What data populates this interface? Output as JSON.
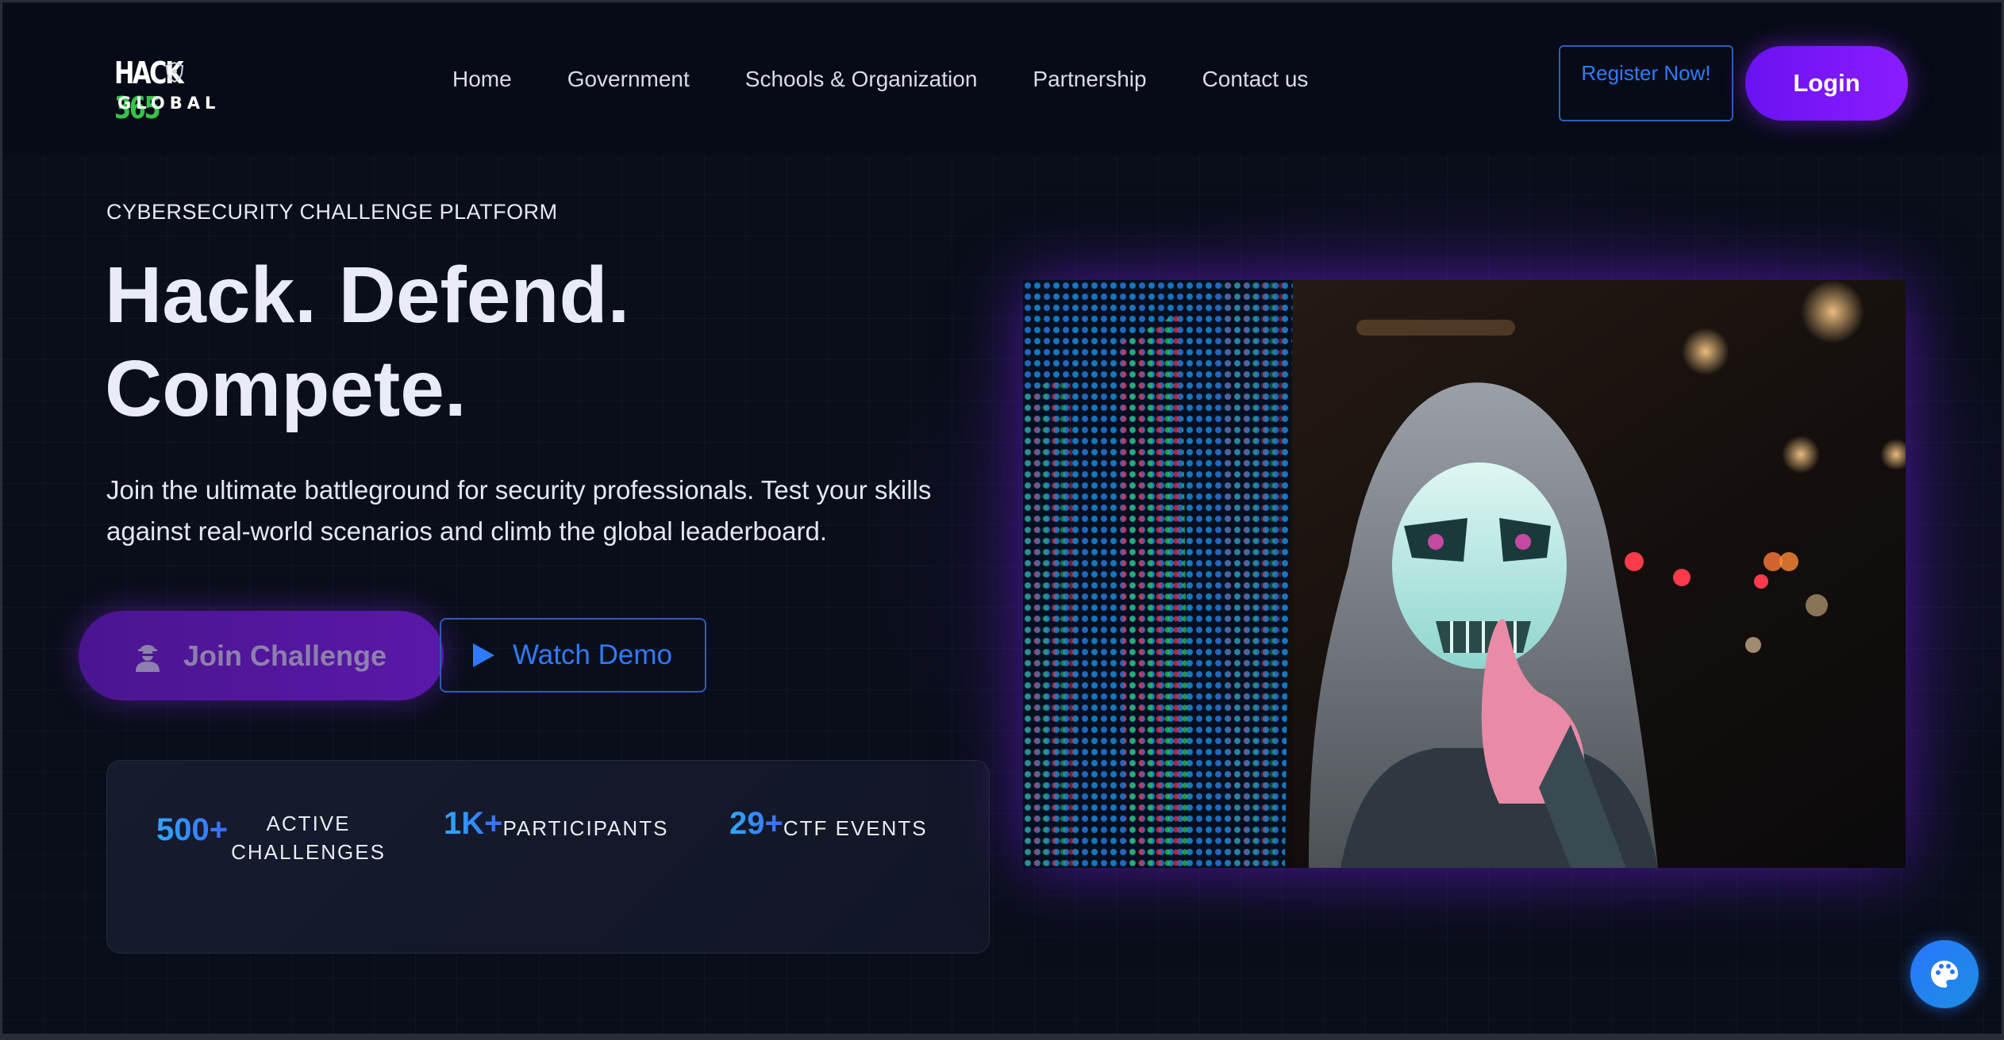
{
  "brand": {
    "logo_top": "HACK",
    "logo_num": "365",
    "logo_bottom": "GLOBAL"
  },
  "nav": {
    "links": [
      {
        "label": "Home"
      },
      {
        "label": "Government"
      },
      {
        "label": "Schools & Organization"
      },
      {
        "label": "Partnership"
      },
      {
        "label": "Contact us"
      }
    ],
    "register_label": "Register Now!",
    "login_label": "Login"
  },
  "hero": {
    "eyebrow": "CYBERSECURITY CHALLENGE PLATFORM",
    "headline_line1": "Hack. Defend.",
    "headline_line2": "Compete.",
    "subtext": "Join the ultimate battleground for security professionals. Test your skills against real-world scenarios and climb the global leaderboard.",
    "join_label": "Join Challenge",
    "demo_label": "Watch Demo"
  },
  "stats": [
    {
      "value": "500+",
      "label_line1": "ACTIVE",
      "label_line2": "CHALLENGES"
    },
    {
      "value": "1K+",
      "label": "PARTICIPANTS"
    },
    {
      "value": "29+",
      "label": "CTF EVENTS"
    }
  ],
  "colors": {
    "accent_purple": "#7a16ff",
    "accent_blue": "#2f7bff",
    "background": "#0a0e1a"
  },
  "icons": {
    "join": "user-secret-icon",
    "demo": "play-icon",
    "floating": "palette-icon"
  }
}
